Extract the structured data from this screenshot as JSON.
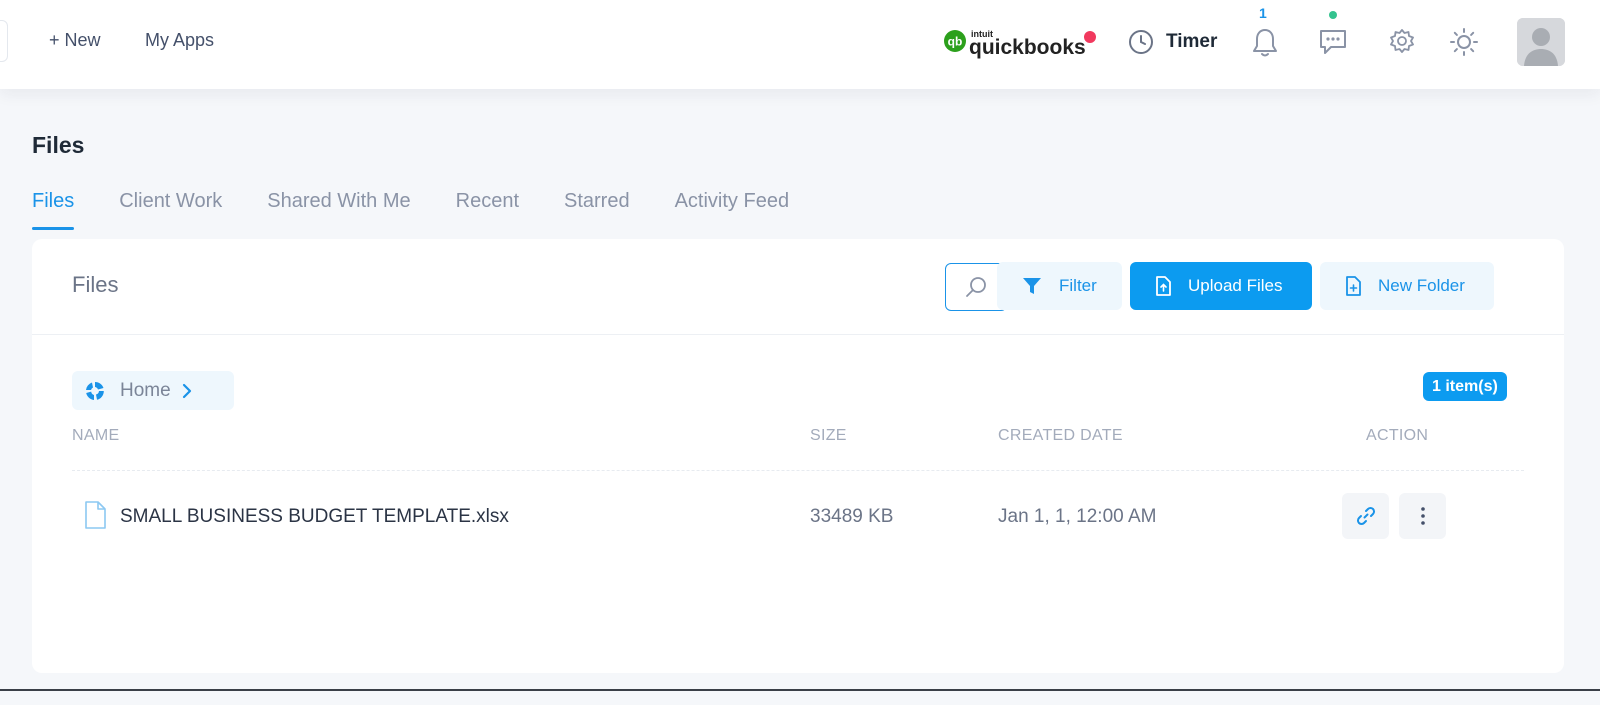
{
  "header": {
    "new_label": "+ New",
    "my_apps_label": "My Apps",
    "quickbooks_brand_small": "intuit",
    "quickbooks_brand": "quickbooks",
    "timer_label": "Timer",
    "notification_count": "1",
    "colors": {
      "accent": "#1a93e8",
      "qb_green": "#2ca01c",
      "qb_dot": "#f1395e",
      "chat_dot": "#34c38f"
    }
  },
  "page": {
    "title": "Files",
    "tabs": [
      {
        "label": "Files",
        "active": true
      },
      {
        "label": "Client Work"
      },
      {
        "label": "Shared With Me"
      },
      {
        "label": "Recent"
      },
      {
        "label": "Starred"
      },
      {
        "label": "Activity Feed"
      }
    ]
  },
  "card": {
    "title": "Files",
    "filter_label": "Filter",
    "upload_label": "Upload Files",
    "new_folder_label": "New Folder",
    "breadcrumb_home": "Home",
    "item_count": "1 item(s)",
    "columns": {
      "name": "NAME",
      "size": "SIZE",
      "created": "CREATED DATE",
      "action": "ACTION"
    },
    "rows": [
      {
        "name": "SMALL BUSINESS BUDGET TEMPLATE.xlsx",
        "size": "33489 KB",
        "created": "Jan 1, 1, 12:00 AM"
      }
    ]
  }
}
